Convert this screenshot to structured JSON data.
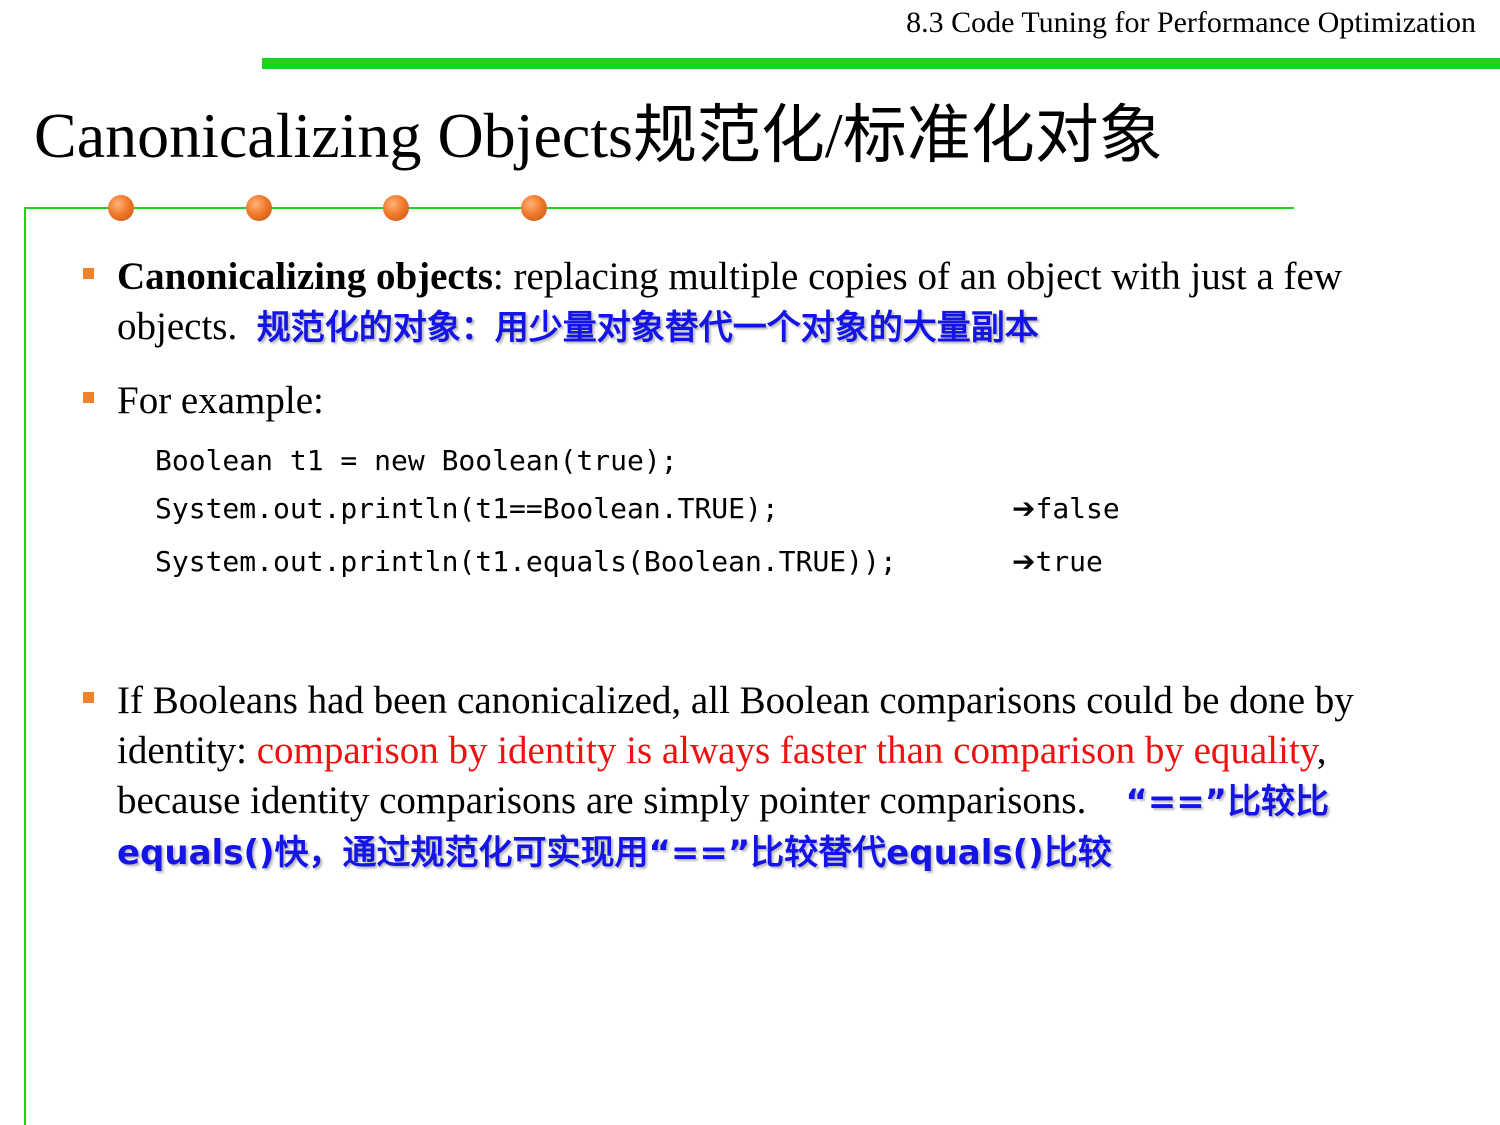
{
  "header": {
    "section": "8.3 Code Tuning for Performance Optimization"
  },
  "slide": {
    "title": "Canonicalizing Objects规范化/标准化对象"
  },
  "bullets": {
    "b1": {
      "term": "Canonicalizing objects",
      "text": ": replacing multiple copies of an object with just a few objects.",
      "cn": "规范化的对象：用少量对象替代一个对象的大量副本"
    },
    "b2": {
      "text": "For example:"
    },
    "b3": {
      "text_a": "If Booleans had been canonicalized, all Boolean comparisons could be done by identity: ",
      "red": "comparison by identity is always faster than comparison by equality",
      "text_b": ", because identity comparisons are simply pointer comparisons.",
      "cn": "“==”比较比equals()快，通过规范化可实现用“==”比较替代equals()比较"
    }
  },
  "code": {
    "lines": [
      "Boolean t1 = new Boolean(true);",
      "System.out.println(t1==Boolean.TRUE);",
      "System.out.println(t1.equals(Boolean.TRUE));"
    ],
    "arrow": "➔",
    "results": [
      "false",
      "true"
    ]
  },
  "colors": {
    "accent_green": "#1dd31d",
    "dot_orange": "#f07a2a",
    "cn_blue": "#1414e6",
    "highlight_red": "#ee1111"
  }
}
